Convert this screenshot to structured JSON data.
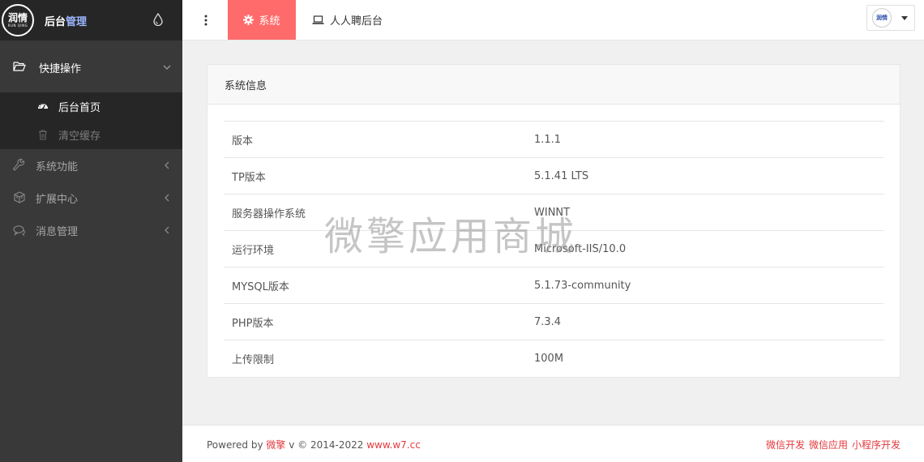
{
  "brand": {
    "logo_text": "润情",
    "logo_sub": "RUN QING",
    "title_a": "后台",
    "title_b": "管理"
  },
  "sidebar": {
    "items": [
      {
        "label": "快捷操作",
        "icon": "folder-open-icon",
        "open": true,
        "children": [
          {
            "label": "后台首页",
            "icon": "dashboard-icon",
            "active": true
          },
          {
            "label": "清空缓存",
            "icon": "trash-icon",
            "active": false
          }
        ]
      },
      {
        "label": "系统功能",
        "icon": "wrench-icon"
      },
      {
        "label": "扩展中心",
        "icon": "cubes-icon"
      },
      {
        "label": "消息管理",
        "icon": "comments-icon"
      }
    ]
  },
  "topbar": {
    "tabs": [
      {
        "label": "系统",
        "icon": "gear-icon",
        "active": true
      },
      {
        "label": "人人聘后台",
        "icon": "laptop-icon",
        "active": false
      }
    ],
    "avatar_text": "润情"
  },
  "panel": {
    "title": "系统信息",
    "rows": [
      {
        "key": "版本",
        "value": "1.1.1"
      },
      {
        "key": "TP版本",
        "value": "5.1.41 LTS"
      },
      {
        "key": "服务器操作系统",
        "value": "WINNT"
      },
      {
        "key": "运行环境",
        "value": "Microsoft-IIS/10.0"
      },
      {
        "key": "MYSQL版本",
        "value": "5.1.73-community"
      },
      {
        "key": "PHP版本",
        "value": "7.3.4"
      },
      {
        "key": "上传限制",
        "value": "100M"
      }
    ]
  },
  "watermark": "微擎应用商城",
  "footer": {
    "powered": "Powered by",
    "brand": "微擎",
    "version": "v © 2014-2022",
    "site": "www.w7.cc",
    "links": [
      "微信开发",
      "微信应用",
      "小程序开发"
    ]
  },
  "colors": {
    "accent": "#ff6b6b",
    "sidebar_bg": "#393939",
    "sidebar_dark": "#262626",
    "link_red": "#e4393c"
  }
}
